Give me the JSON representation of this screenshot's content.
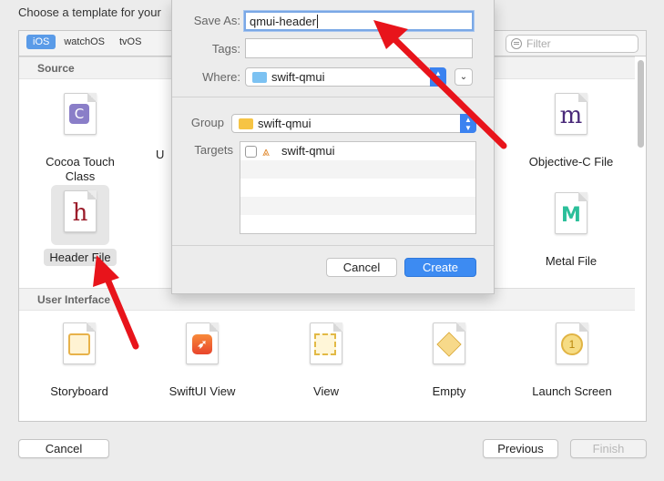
{
  "heading": "Choose a template for your",
  "platforms": [
    "iOS",
    "watchOS",
    "tvOS"
  ],
  "filter_placeholder": "Filter",
  "sections": {
    "source": "Source",
    "user_interface": "User Interface"
  },
  "source_templates": [
    {
      "label": "Cocoa Touch Class",
      "glyph": "C"
    },
    {
      "label": "Header File",
      "glyph": "h"
    },
    {
      "label": "Objective-C File",
      "glyph": "m"
    },
    {
      "label": "Metal File",
      "glyph": "M"
    }
  ],
  "ui_templates": [
    {
      "label": "Storyboard"
    },
    {
      "label": "SwiftUI View"
    },
    {
      "label": "View"
    },
    {
      "label": "Empty"
    },
    {
      "label": "Launch Screen"
    }
  ],
  "partial_label": "U",
  "bottom_buttons": {
    "cancel": "Cancel",
    "previous": "Previous",
    "finish": "Finish"
  },
  "save_sheet": {
    "save_as_label": "Save As:",
    "save_as_value": "qmui-header",
    "tags_label": "Tags:",
    "where_label": "Where:",
    "where_value": "swift-qmui",
    "group_label": "Group",
    "group_value": "swift-qmui",
    "targets_label": "Targets",
    "target_name": "swift-qmui",
    "cancel": "Cancel",
    "create": "Create"
  },
  "colors": {
    "accent": "#3d8bf2",
    "arrow": "#e8141b"
  }
}
